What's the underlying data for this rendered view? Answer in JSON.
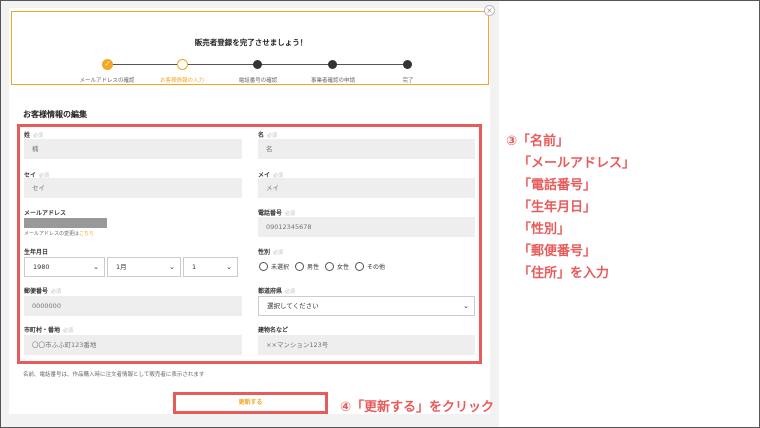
{
  "progress": {
    "title": "販売者登録を完了させましょう！",
    "steps": [
      {
        "label": "メールアドレスの確認"
      },
      {
        "label": "お客様情報の入力"
      },
      {
        "label": "電話番号の確認"
      },
      {
        "label": "事業者確認の申請"
      },
      {
        "label": "完了"
      }
    ],
    "done_mark": "✓"
  },
  "form": {
    "heading": "お客様情報の編集",
    "required": "必須",
    "sei": {
      "label": "姓",
      "placeholder": "楠"
    },
    "mei": {
      "label": "名",
      "placeholder": "名"
    },
    "sei_kana": {
      "label": "セイ",
      "placeholder": "セイ"
    },
    "mei_kana": {
      "label": "メイ",
      "placeholder": "メイ"
    },
    "email": {
      "label": "メールアドレス",
      "note_prefix": "メールアドレスの変更は",
      "note_link": "こちら"
    },
    "phone": {
      "label": "電話番号",
      "placeholder": "09012345678"
    },
    "birthdate": {
      "label": "生年月日",
      "year": "1980",
      "month": "1月",
      "day": "1"
    },
    "gender": {
      "label": "性別",
      "options": [
        "未選択",
        "男性",
        "女性",
        "その他"
      ]
    },
    "postal": {
      "label": "郵便番号",
      "placeholder": "0000000"
    },
    "prefecture": {
      "label": "都道府県",
      "value": "選択してください"
    },
    "city": {
      "label": "市町村・番地",
      "placeholder": "〇〇市ふふ町123番地"
    },
    "building": {
      "label": "建物名など",
      "placeholder": "××マンション123号"
    },
    "footnote": "名前、電話番号は、作品購入時に注文者情報として販売者に表示されます",
    "submit_label": "更新する"
  },
  "annotations": {
    "step3": [
      "③「名前」",
      "「メールアドレス」",
      "「電話番号」",
      "「生年月日」",
      "「性別」",
      "「郵便番号」",
      "「住所」を入力"
    ],
    "step4": "④「更新する」をクリック"
  },
  "colors": {
    "accent": "#f5a623",
    "highlight": "#e85b5b"
  }
}
